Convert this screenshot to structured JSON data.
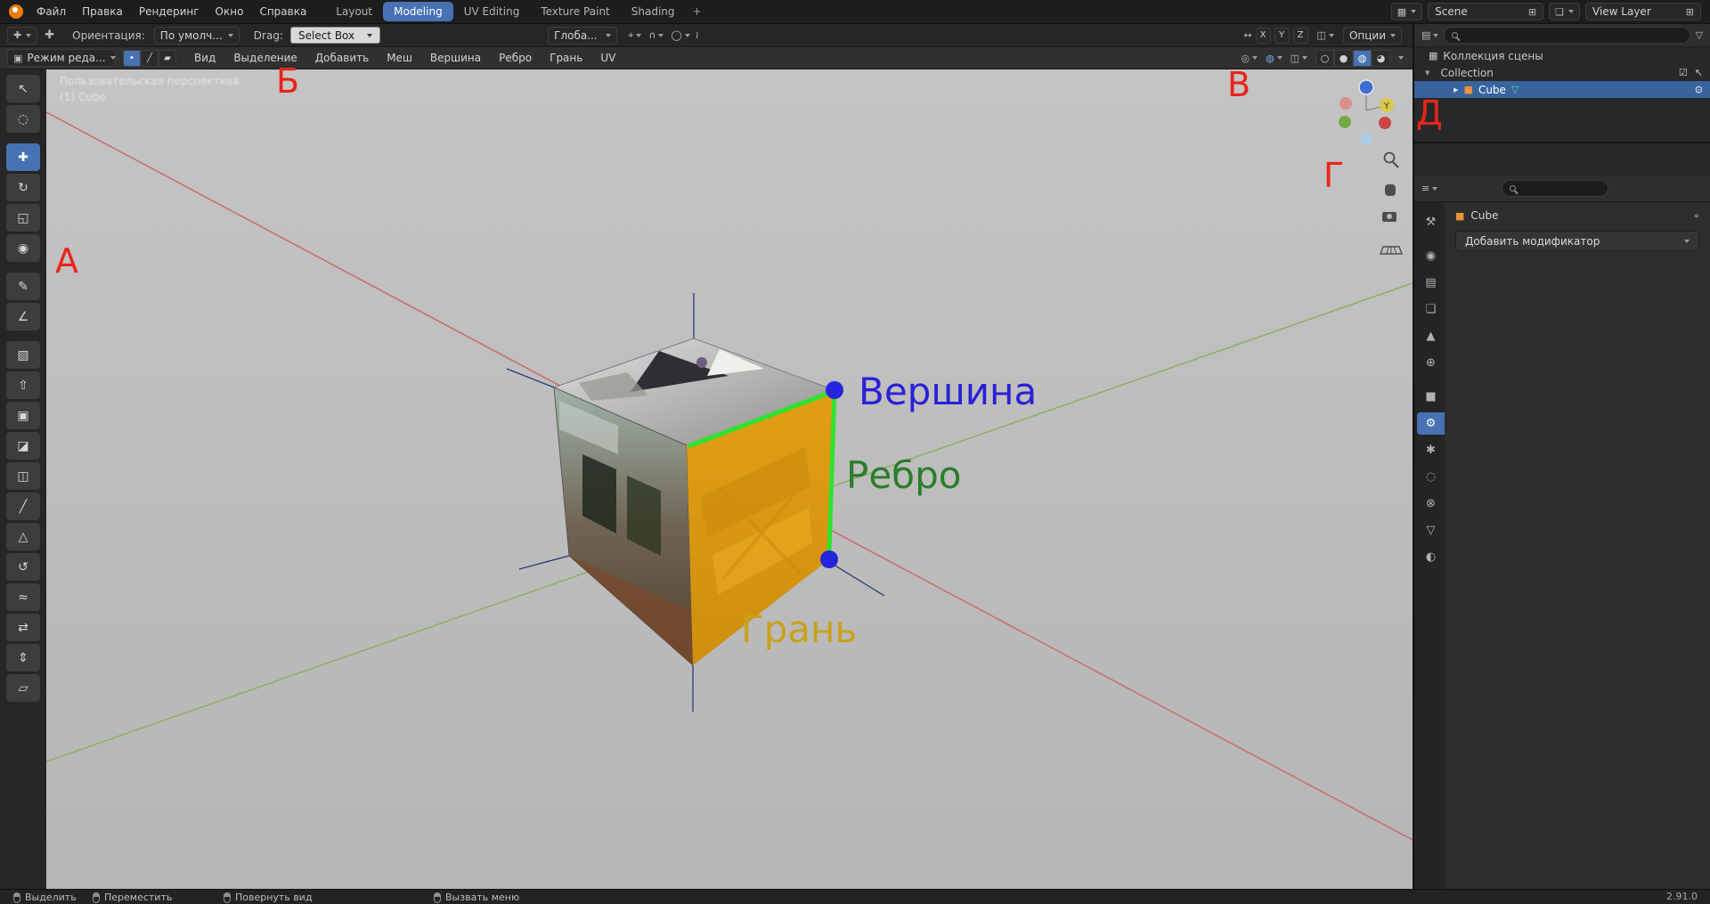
{
  "colors": {
    "accent": "#4772b3",
    "selection_row": "#38639c",
    "vertex_label_color": "#2a21d6",
    "edge_label_color": "#2c7d2a",
    "face_label_color": "#c9a11b",
    "marker_color": "#e8241c",
    "object_orange": "#e8943c",
    "viewport_bg": "#bdbdbd"
  },
  "topbar": {
    "menus": [
      "Файл",
      "Правка",
      "Рендеринг",
      "Окно",
      "Справка"
    ],
    "tabs": [
      "Layout",
      "Modeling",
      "UV Editing",
      "Texture Paint",
      "Shading"
    ],
    "active_tab": "Modeling",
    "add_tab_label": "+",
    "scene": {
      "label": "Scene"
    },
    "view_layer": {
      "label": "View Layer"
    },
    "icons": {
      "scene": "▦",
      "view_layer": "❏",
      "new": "⊞"
    }
  },
  "tool_settings": {
    "orientation_label": "Ориентация:",
    "orientation_value": "По умолч...",
    "drag_label": "Drag:",
    "drag_value": "Select Box",
    "transform_orientation_value": "Глоба...",
    "axis_toggles": [
      "X",
      "Y",
      "Z"
    ],
    "options_label": "Опции",
    "icons": {
      "active_tool": "✚",
      "pivot": "⌖",
      "snap": "∩",
      "proportional": "◯",
      "falloff": "≀",
      "mirror": "◫",
      "swap": "↔"
    }
  },
  "viewport_header": {
    "mode_value": "Режим реда...",
    "menus": [
      "Вид",
      "Выделение",
      "Добавить",
      "Меш",
      "Вершина",
      "Ребро",
      "Грань",
      "UV"
    ],
    "select_modes": [
      {
        "name": "vertex-select",
        "glyph": "•",
        "active": true
      },
      {
        "name": "edge-select",
        "glyph": "╱",
        "active": false
      },
      {
        "name": "face-select",
        "glyph": "▰",
        "active": false
      }
    ],
    "shading": [
      {
        "name": "wireframe",
        "glyph": "○"
      },
      {
        "name": "solid",
        "glyph": "●"
      },
      {
        "name": "material-preview",
        "glyph": "◍",
        "active": true
      },
      {
        "name": "rendered",
        "glyph": "◕"
      }
    ],
    "icons": {
      "mode": "▣",
      "gizmo": "◎",
      "overlays": "◍",
      "xray": "◫"
    }
  },
  "toolbar": {
    "tools": [
      {
        "name": "select-box",
        "glyph": "↖"
      },
      {
        "name": "cursor",
        "glyph": "◌"
      },
      {
        "name": "move",
        "glyph": "✚",
        "active": true
      },
      {
        "name": "rotate",
        "glyph": "↻"
      },
      {
        "name": "scale",
        "glyph": "◱"
      },
      {
        "name": "transform",
        "glyph": "◉"
      },
      {
        "name": "annotate",
        "glyph": "✎"
      },
      {
        "name": "measure",
        "glyph": "∠"
      },
      {
        "name": "add-cube",
        "glyph": "▧"
      },
      {
        "name": "extrude-region",
        "glyph": "⇧"
      },
      {
        "name": "inset-faces",
        "glyph": "▣"
      },
      {
        "name": "bevel",
        "glyph": "◪"
      },
      {
        "name": "loop-cut",
        "glyph": "◫"
      },
      {
        "name": "knife",
        "glyph": "╱"
      },
      {
        "name": "poly-build",
        "glyph": "△"
      },
      {
        "name": "spin",
        "glyph": "↺"
      },
      {
        "name": "smooth",
        "glyph": "≈"
      },
      {
        "name": "edge-slide",
        "glyph": "⇄"
      },
      {
        "name": "shrink-fatten",
        "glyph": "⇕"
      },
      {
        "name": "shear",
        "glyph": "▱"
      }
    ]
  },
  "viewport": {
    "perspective_text": "Пользовательская перспектива",
    "object_text": "(1) Cube",
    "annotations": {
      "vertex": "Вершина",
      "edge": "Ребро",
      "face": "Грань"
    },
    "markers": [
      "А",
      "Б",
      "В",
      "Г",
      "Д"
    ],
    "gizmo_axis_label": "Y"
  },
  "outliner": {
    "title_row": "Коллекция сцены",
    "collection_row": "Collection",
    "object_row": "Cube",
    "icons": {
      "editor": "▤",
      "funnel": "▽",
      "scene_collection": "▦",
      "collection": "▥",
      "cube": "■",
      "mesh_data": "▽",
      "check": "☑",
      "pointer": "↖",
      "eye": "⊙",
      "expand_open": "▾",
      "expand_closed": "▸"
    }
  },
  "properties": {
    "object_name": "Cube",
    "add_modifier_label": "Добавить модификатор",
    "icons": {
      "editor": "≡",
      "pin": "⌖",
      "breadcrumb_cube": "■"
    },
    "tabs": [
      {
        "name": "tool",
        "glyph": "⚒"
      },
      {
        "name": "render",
        "glyph": "◉"
      },
      {
        "name": "output",
        "glyph": "▤"
      },
      {
        "name": "view-layer",
        "glyph": "❏"
      },
      {
        "name": "scene",
        "glyph": "▲"
      },
      {
        "name": "world",
        "glyph": "⊕"
      },
      {
        "name": "object",
        "glyph": "■"
      },
      {
        "name": "modifiers",
        "glyph": "⚙",
        "active": true
      },
      {
        "name": "particles",
        "glyph": "✱"
      },
      {
        "name": "physics",
        "glyph": "◌"
      },
      {
        "name": "constraints",
        "glyph": "⊗"
      },
      {
        "name": "object-data",
        "glyph": "▽"
      },
      {
        "name": "material",
        "glyph": "◐"
      }
    ]
  },
  "statusbar": {
    "hints": [
      "Выделить",
      "Переместить",
      "Повернуть вид",
      "Вызвать меню"
    ],
    "version": "2.91.0"
  }
}
